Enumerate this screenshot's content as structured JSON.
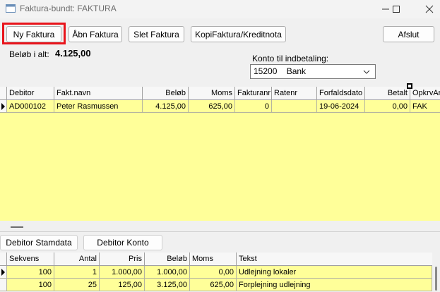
{
  "window": {
    "title": "Faktura-bundt: FAKTURA",
    "minimize_icon": "minimize-icon",
    "maximize_icon": "maximize-icon",
    "close_icon": "close-icon"
  },
  "toolbar": {
    "new_invoice": "Ny Faktura",
    "open_invoice": "Åbn Faktura",
    "delete_invoice": "Slet Faktura",
    "copy_credit": "KopiFaktura/Kreditnota",
    "close": "Afslut"
  },
  "summary": {
    "total_label": "Beløb i alt:",
    "total_value": "4.125,00"
  },
  "payment_account": {
    "label": "Konto til indbetaling:",
    "selected": "15200    Bank"
  },
  "invoice_table": {
    "columns": [
      "Debitor",
      "Fakt.navn",
      "Beløb",
      "Moms",
      "Fakturanr",
      "Ratenr",
      "Forfaldsdato",
      "Betalt",
      "OpkrvAr"
    ],
    "rows": [
      [
        "AD000102",
        "Peter Rasmussen",
        "4.125,00",
        "625,00",
        "0",
        "",
        "19-06-2024",
        "0,00",
        "FAK"
      ]
    ]
  },
  "tabs": {
    "debtor_master": "Debitor Stamdata",
    "debtor_account": "Debitor Konto"
  },
  "lines_table": {
    "columns": [
      "Sekvens",
      "Antal",
      "Pris",
      "Beløb",
      "Moms",
      "Tekst"
    ],
    "rows": [
      [
        "100",
        "1",
        "1.000,00",
        "1.000,00",
        "0,00",
        "Udlejning lokaler"
      ],
      [
        "100",
        "25",
        "125,00",
        "3.125,00",
        "625,00",
        "Forplejning udlejning"
      ]
    ]
  },
  "colors": {
    "grid_background": "#ffff99",
    "highlight_border": "#e8141b"
  }
}
